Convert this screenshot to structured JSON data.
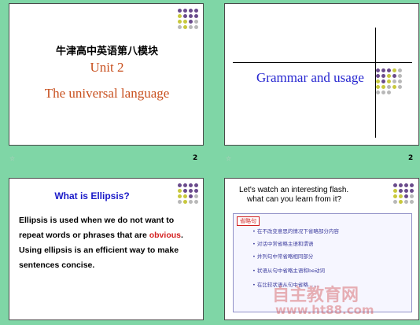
{
  "slides": [
    {
      "number": "2",
      "cn_title": "牛津高中英语第八模块",
      "unit": "Unit 2",
      "subtitle": "The universal language"
    },
    {
      "number": "2",
      "title": "Grammar and usage"
    },
    {
      "title": "What is Ellipsis?",
      "body_before": "Ellipsis is used when we do not want to repeat words or phrases that are ",
      "body_highlight": "obvious",
      "body_after": ". Using ellipsis is an efficient way to make sentences concise."
    },
    {
      "prompt_line1": "Let's watch an interesting flash.",
      "prompt_line2": "what can you learn from it?",
      "panel_label": "省略句",
      "panel_lines": [
        "• 在不改变意思的情况下省略部分内容",
        "• 对话中常省略主语和谓语",
        "• 并列句中常省略相同部分",
        "• 状语从句中省略主语和be动词",
        "• 在比较状语从句中省略……"
      ]
    }
  ],
  "watermark": {
    "line1": "自主教育网",
    "line2": "www.ht88.com"
  },
  "colors": {
    "background": "#7fd6a6",
    "orange": "#c8501e",
    "blue": "#2626d0",
    "red": "#d42020"
  }
}
